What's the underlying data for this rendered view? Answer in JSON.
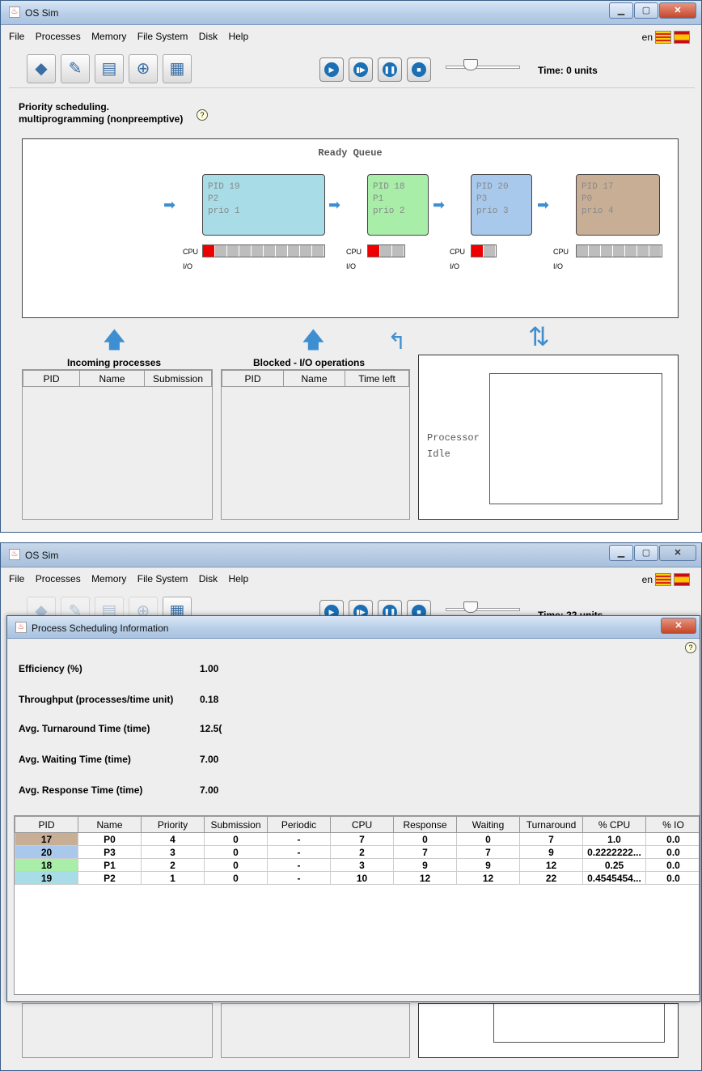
{
  "win1": {
    "title": "OS Sim",
    "menu": [
      "File",
      "Processes",
      "Memory",
      "File System",
      "Disk",
      "Help"
    ],
    "lang": "en",
    "time": "Time: 0 units",
    "algo_line1": "Priority scheduling.",
    "algo_line2": "multiprogramming (nonpreemptive)",
    "ready_queue_title": "Ready Queue",
    "processes": [
      {
        "pid": "PID 19",
        "name": "P2",
        "prio": "prio 1",
        "color": "#a8dde8",
        "cpu": 10,
        "cpu_red": 1
      },
      {
        "pid": "PID 18",
        "name": "P1",
        "prio": "prio 2",
        "color": "#a8eea8",
        "cpu": 3,
        "cpu_red": 1
      },
      {
        "pid": "PID 20",
        "name": "P3",
        "prio": "prio 3",
        "color": "#a9c9ec",
        "cpu": 2,
        "cpu_red": 1
      },
      {
        "pid": "PID 17",
        "name": "P0",
        "prio": "prio 4",
        "color": "#c9ae96",
        "cpu": 7,
        "cpu_red": 0
      }
    ],
    "cpu_label": "CPU",
    "io_label": "I/O",
    "incoming_title": "Incoming processes",
    "incoming_cols": [
      "PID",
      "Name",
      "Submission"
    ],
    "blocked_title": "Blocked - I/O operations",
    "blocked_cols": [
      "PID",
      "Name",
      "Time left"
    ],
    "processor_line1": "Processor",
    "processor_line2": "Idle"
  },
  "win2": {
    "title": "OS Sim",
    "menu": [
      "File",
      "Processes",
      "Memory",
      "File System",
      "Disk",
      "Help"
    ],
    "lang": "en",
    "time": "Time: 22 units"
  },
  "dialog": {
    "title": "Process Scheduling Information",
    "stats": [
      {
        "label": "Efficiency (%)",
        "value": "1.00"
      },
      {
        "label": "Throughput (processes/time unit)",
        "value": "0.18"
      },
      {
        "label": "Avg. Turnaround Time (time)",
        "value": "12.5("
      },
      {
        "label": "Avg. Waiting Time (time)",
        "value": "7.00"
      },
      {
        "label": "Avg. Response Time (time)",
        "value": "7.00"
      }
    ],
    "columns": [
      "PID",
      "Name",
      "Priority",
      "Submission",
      "Periodic",
      "CPU",
      "Response",
      "Waiting",
      "Turnaround",
      "% CPU",
      "% IO"
    ],
    "rows": [
      {
        "color": "#c9ae96",
        "cells": [
          "17",
          "P0",
          "4",
          "0",
          "-",
          "7",
          "0",
          "0",
          "7",
          "1.0",
          "0.0"
        ]
      },
      {
        "color": "#a9c9ec",
        "cells": [
          "20",
          "P3",
          "3",
          "0",
          "-",
          "2",
          "7",
          "7",
          "9",
          "0.2222222...",
          "0.0"
        ]
      },
      {
        "color": "#a8eea8",
        "cells": [
          "18",
          "P1",
          "2",
          "0",
          "-",
          "3",
          "9",
          "9",
          "12",
          "0.25",
          "0.0"
        ]
      },
      {
        "color": "#a8dde8",
        "cells": [
          "19",
          "P2",
          "1",
          "0",
          "-",
          "10",
          "12",
          "12",
          "22",
          "0.4545454...",
          "0.0"
        ]
      }
    ]
  }
}
